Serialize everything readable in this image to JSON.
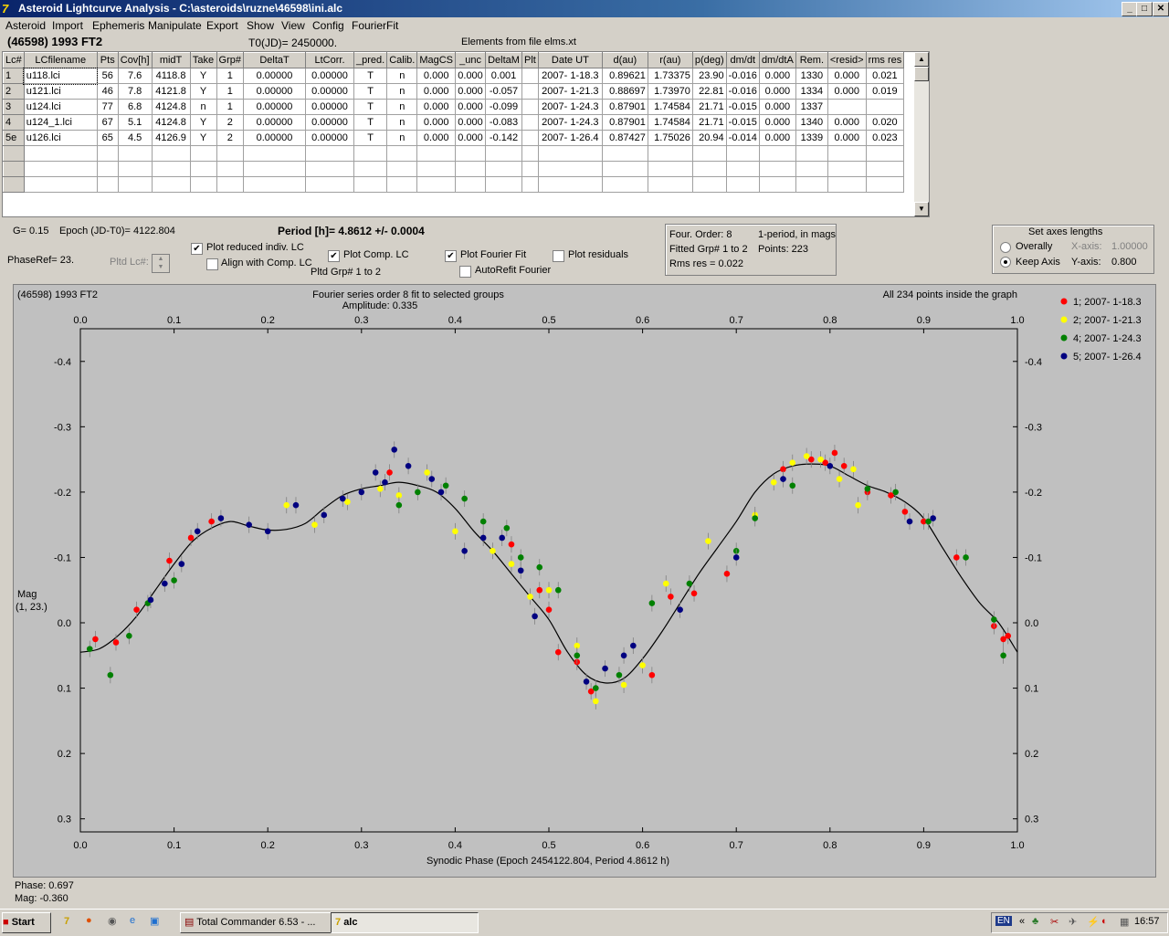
{
  "window": {
    "title": "Asteroid Lightcurve Analysis - C:\\asteroids\\ruzne\\46598\\ini.alc",
    "min": "_",
    "max": "□",
    "close": "✕"
  },
  "menu": [
    "Asteroid",
    "Import",
    "Ephemeris",
    "Manipulate",
    "Export",
    "Show",
    "View",
    "Config",
    "FourierFit"
  ],
  "header": {
    "object": "(46598) 1993 FT2",
    "t0": "T0(JD)= 2450000.",
    "elements": "Elements from file elms.xt"
  },
  "table": {
    "columns": [
      "Lc#",
      "LCfilename",
      "Pts",
      "Cov[h]",
      "midT",
      "Take",
      "Grp#",
      "DeltaT",
      "LtCorr.",
      "_pred.",
      "Calib.",
      "MagCS",
      "_unc",
      "DeltaM",
      "Plt",
      "Date UT",
      "d(au)",
      "r(au)",
      "p(deg)",
      "dm/dt",
      "dm/dtA",
      "Rem.",
      "<resid>",
      "rms res"
    ],
    "rows": [
      [
        "1",
        "u118.lci",
        "56",
        "7.6",
        "4118.8",
        "Y",
        "1",
        "0.00000",
        "0.00000",
        "T",
        "n",
        "0.000",
        "0.000",
        "0.001",
        "",
        "2007- 1-18.3",
        "0.89621",
        "1.73375",
        "23.90",
        "-0.016",
        "0.000",
        "1330",
        "0.000",
        "0.021"
      ],
      [
        "2",
        "u121.lci",
        "46",
        "7.8",
        "4121.8",
        "Y",
        "1",
        "0.00000",
        "0.00000",
        "T",
        "n",
        "0.000",
        "0.000",
        "-0.057",
        "",
        "2007- 1-21.3",
        "0.88697",
        "1.73970",
        "22.81",
        "-0.016",
        "0.000",
        "1334",
        "0.000",
        "0.019"
      ],
      [
        "3",
        "u124.lci",
        "77",
        "6.8",
        "4124.8",
        "n",
        "1",
        "0.00000",
        "0.00000",
        "T",
        "n",
        "0.000",
        "0.000",
        "-0.099",
        "",
        "2007- 1-24.3",
        "0.87901",
        "1.74584",
        "21.71",
        "-0.015",
        "0.000",
        "1337",
        "",
        ""
      ],
      [
        "4",
        "u124_1.lci",
        "67",
        "5.1",
        "4124.8",
        "Y",
        "2",
        "0.00000",
        "0.00000",
        "T",
        "n",
        "0.000",
        "0.000",
        "-0.083",
        "",
        "2007- 1-24.3",
        "0.87901",
        "1.74584",
        "21.71",
        "-0.015",
        "0.000",
        "1340",
        "0.000",
        "0.020"
      ],
      [
        "5e",
        "u126.lci",
        "65",
        "4.5",
        "4126.9",
        "Y",
        "2",
        "0.00000",
        "0.00000",
        "T",
        "n",
        "0.000",
        "0.000",
        "-0.142",
        "",
        "2007- 1-26.4",
        "0.87427",
        "1.75026",
        "20.94",
        "-0.014",
        "0.000",
        "1339",
        "0.000",
        "0.023"
      ]
    ]
  },
  "controls": {
    "g": "G= 0.15",
    "epoch": "Epoch (JD-T0)= 4122.804",
    "period": "Period [h]= 4.8612 +/- 0.0004",
    "phaseref": "PhaseRef= 23.",
    "pltd_lc": "Pltd Lc#:",
    "plot_reduced": "Plot reduced indiv. LC",
    "align_comp": "Align with Comp. LC",
    "plot_comp": "Plot Comp. LC",
    "pltd_grp": "Pltd Grp#  1   to   2",
    "plot_fourier": "Plot Fourier Fit",
    "autorefit": "AutoRefit Fourier",
    "plot_resid": "Plot residuals",
    "four_order": "Four. Order:  8",
    "one_period": "1-period, in mags",
    "fitted_grp": "Fitted Grp# 1 to 2",
    "points": "Points: 223",
    "rms": "Rms res      = 0.022",
    "axes_title": "Set axes lengths",
    "overally": "Overally",
    "keep_axis": "Keep Axis",
    "xaxis_label": "X-axis:",
    "xaxis_val": "1.00000",
    "yaxis_label": "Y-axis:",
    "yaxis_val": "0.800"
  },
  "status": {
    "phase": "Phase:  0.697",
    "mag": "Mag:    -0.360"
  },
  "taskbar": {
    "start": "Start",
    "tc": "Total Commander 6.53 - ...",
    "alc": "alc",
    "en": "EN",
    "time": "16:57"
  },
  "colors": {
    "g1": "#ff0000",
    "g2": "#ffff00",
    "g4": "#008000",
    "g5": "#000080"
  },
  "chart_data": {
    "type": "scatter",
    "title_left": "(46598) 1993 FT2",
    "title_center": "Fourier series order 8 fit to selected groups",
    "subtitle": "Amplitude: 0.335",
    "title_right": "All 234 points inside the graph",
    "xlabel": "Synodic Phase (Epoch 2454122.804, Period 4.8612 h)",
    "ylabel": "Mag",
    "ylabel2": "(1, 23.)",
    "xlim": [
      0.0,
      1.0
    ],
    "ylim": [
      -0.45,
      0.32
    ],
    "y_inverted": true,
    "x_ticks": [
      "0.0",
      "0.1",
      "0.2",
      "0.3",
      "0.4",
      "0.5",
      "0.6",
      "0.7",
      "0.8",
      "0.9",
      "1.0"
    ],
    "y_ticks": [
      "-0.4",
      "-0.3",
      "-0.2",
      "-0.1",
      "0.0",
      "0.1",
      "0.2",
      "0.3"
    ],
    "legend": [
      "1; 2007- 1-18.3",
      "2; 2007- 1-21.3",
      "4; 2007- 1-24.3",
      "5; 2007- 1-26.4"
    ],
    "legend_position": "right",
    "fit_curve": [
      [
        0.0,
        0.045
      ],
      [
        0.02,
        0.04
      ],
      [
        0.04,
        0.02
      ],
      [
        0.06,
        -0.01
      ],
      [
        0.08,
        -0.05
      ],
      [
        0.1,
        -0.09
      ],
      [
        0.12,
        -0.125
      ],
      [
        0.14,
        -0.145
      ],
      [
        0.16,
        -0.155
      ],
      [
        0.18,
        -0.148
      ],
      [
        0.2,
        -0.142
      ],
      [
        0.22,
        -0.143
      ],
      [
        0.24,
        -0.152
      ],
      [
        0.26,
        -0.175
      ],
      [
        0.28,
        -0.195
      ],
      [
        0.3,
        -0.205
      ],
      [
        0.32,
        -0.21
      ],
      [
        0.34,
        -0.215
      ],
      [
        0.36,
        -0.21
      ],
      [
        0.38,
        -0.2
      ],
      [
        0.4,
        -0.175
      ],
      [
        0.42,
        -0.14
      ],
      [
        0.44,
        -0.11
      ],
      [
        0.46,
        -0.075
      ],
      [
        0.48,
        -0.04
      ],
      [
        0.5,
        -0.005
      ],
      [
        0.52,
        0.045
      ],
      [
        0.54,
        0.08
      ],
      [
        0.56,
        0.092
      ],
      [
        0.58,
        0.085
      ],
      [
        0.6,
        0.055
      ],
      [
        0.62,
        0.015
      ],
      [
        0.64,
        -0.03
      ],
      [
        0.66,
        -0.075
      ],
      [
        0.68,
        -0.115
      ],
      [
        0.7,
        -0.155
      ],
      [
        0.72,
        -0.2
      ],
      [
        0.74,
        -0.228
      ],
      [
        0.76,
        -0.24
      ],
      [
        0.78,
        -0.243
      ],
      [
        0.8,
        -0.24
      ],
      [
        0.82,
        -0.225
      ],
      [
        0.84,
        -0.21
      ],
      [
        0.86,
        -0.2
      ],
      [
        0.88,
        -0.185
      ],
      [
        0.9,
        -0.16
      ],
      [
        0.92,
        -0.115
      ],
      [
        0.94,
        -0.07
      ],
      [
        0.96,
        -0.03
      ],
      [
        0.98,
        0.0
      ],
      [
        1.0,
        0.045
      ]
    ],
    "series": [
      {
        "name": "1; 2007- 1-18.3",
        "group": "g1",
        "points": [
          [
            0.016,
            0.025
          ],
          [
            0.038,
            0.03
          ],
          [
            0.06,
            -0.02
          ],
          [
            0.095,
            -0.095
          ],
          [
            0.118,
            -0.13
          ],
          [
            0.14,
            -0.155
          ],
          [
            0.33,
            -0.23
          ],
          [
            0.46,
            -0.12
          ],
          [
            0.49,
            -0.05
          ],
          [
            0.5,
            -0.02
          ],
          [
            0.51,
            0.045
          ],
          [
            0.53,
            0.06
          ],
          [
            0.545,
            0.105
          ],
          [
            0.61,
            0.08
          ],
          [
            0.63,
            -0.04
          ],
          [
            0.655,
            -0.045
          ],
          [
            0.69,
            -0.075
          ],
          [
            0.75,
            -0.235
          ],
          [
            0.78,
            -0.25
          ],
          [
            0.795,
            -0.245
          ],
          [
            0.805,
            -0.26
          ],
          [
            0.815,
            -0.24
          ],
          [
            0.84,
            -0.2
          ],
          [
            0.865,
            -0.195
          ],
          [
            0.88,
            -0.17
          ],
          [
            0.9,
            -0.155
          ],
          [
            0.935,
            -0.1
          ],
          [
            0.975,
            0.005
          ],
          [
            0.985,
            0.025
          ],
          [
            0.99,
            0.02
          ]
        ]
      },
      {
        "name": "2; 2007- 1-21.3",
        "group": "g2",
        "points": [
          [
            0.22,
            -0.18
          ],
          [
            0.25,
            -0.15
          ],
          [
            0.285,
            -0.185
          ],
          [
            0.32,
            -0.205
          ],
          [
            0.34,
            -0.195
          ],
          [
            0.37,
            -0.23
          ],
          [
            0.4,
            -0.14
          ],
          [
            0.44,
            -0.11
          ],
          [
            0.46,
            -0.09
          ],
          [
            0.48,
            -0.04
          ],
          [
            0.5,
            -0.05
          ],
          [
            0.53,
            0.035
          ],
          [
            0.55,
            0.12
          ],
          [
            0.58,
            0.095
          ],
          [
            0.6,
            0.065
          ],
          [
            0.625,
            -0.06
          ],
          [
            0.67,
            -0.125
          ],
          [
            0.72,
            -0.165
          ],
          [
            0.74,
            -0.215
          ],
          [
            0.76,
            -0.245
          ],
          [
            0.775,
            -0.255
          ],
          [
            0.79,
            -0.25
          ],
          [
            0.81,
            -0.22
          ],
          [
            0.825,
            -0.235
          ],
          [
            0.83,
            -0.18
          ]
        ]
      },
      {
        "name": "4; 2007- 1-24.3",
        "group": "g4",
        "points": [
          [
            0.01,
            0.04
          ],
          [
            0.032,
            0.08
          ],
          [
            0.052,
            0.02
          ],
          [
            0.072,
            -0.03
          ],
          [
            0.1,
            -0.065
          ],
          [
            0.34,
            -0.18
          ],
          [
            0.36,
            -0.2
          ],
          [
            0.39,
            -0.21
          ],
          [
            0.41,
            -0.19
          ],
          [
            0.43,
            -0.155
          ],
          [
            0.455,
            -0.145
          ],
          [
            0.47,
            -0.1
          ],
          [
            0.49,
            -0.085
          ],
          [
            0.51,
            -0.05
          ],
          [
            0.53,
            0.05
          ],
          [
            0.55,
            0.1
          ],
          [
            0.575,
            0.08
          ],
          [
            0.61,
            -0.03
          ],
          [
            0.65,
            -0.06
          ],
          [
            0.7,
            -0.11
          ],
          [
            0.72,
            -0.16
          ],
          [
            0.76,
            -0.21
          ],
          [
            0.84,
            -0.205
          ],
          [
            0.87,
            -0.2
          ],
          [
            0.905,
            -0.155
          ],
          [
            0.945,
            -0.1
          ],
          [
            0.975,
            -0.005
          ],
          [
            0.985,
            0.05
          ]
        ]
      },
      {
        "name": "5; 2007- 1-26.4",
        "group": "g5",
        "points": [
          [
            0.075,
            -0.035
          ],
          [
            0.09,
            -0.06
          ],
          [
            0.108,
            -0.09
          ],
          [
            0.125,
            -0.14
          ],
          [
            0.15,
            -0.16
          ],
          [
            0.18,
            -0.15
          ],
          [
            0.2,
            -0.14
          ],
          [
            0.23,
            -0.18
          ],
          [
            0.26,
            -0.165
          ],
          [
            0.28,
            -0.19
          ],
          [
            0.3,
            -0.2
          ],
          [
            0.315,
            -0.23
          ],
          [
            0.325,
            -0.215
          ],
          [
            0.335,
            -0.265
          ],
          [
            0.35,
            -0.24
          ],
          [
            0.375,
            -0.22
          ],
          [
            0.385,
            -0.2
          ],
          [
            0.41,
            -0.11
          ],
          [
            0.43,
            -0.13
          ],
          [
            0.45,
            -0.13
          ],
          [
            0.47,
            -0.08
          ],
          [
            0.485,
            -0.01
          ],
          [
            0.54,
            0.09
          ],
          [
            0.56,
            0.07
          ],
          [
            0.58,
            0.05
          ],
          [
            0.59,
            0.035
          ],
          [
            0.64,
            -0.02
          ],
          [
            0.7,
            -0.1
          ],
          [
            0.75,
            -0.22
          ],
          [
            0.8,
            -0.24
          ],
          [
            0.885,
            -0.155
          ],
          [
            0.91,
            -0.16
          ]
        ]
      }
    ]
  }
}
